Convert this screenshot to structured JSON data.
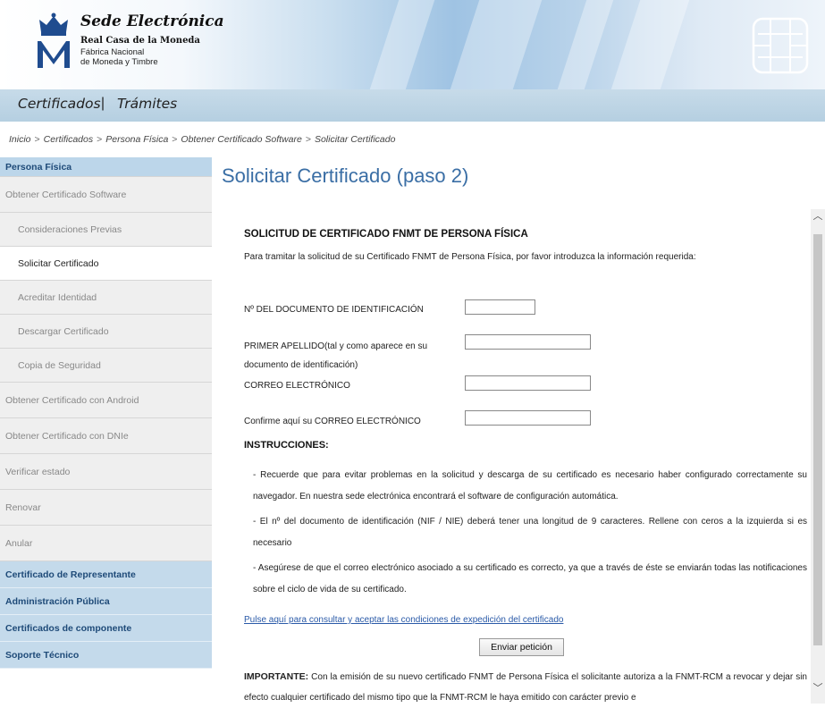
{
  "header": {
    "brand_title": "Sede Electrónica",
    "brand_line1": "Real Casa de la Moneda",
    "brand_line2": "Fábrica Nacional",
    "brand_line3": "de Moneda y Timbre"
  },
  "nav": {
    "certificados": "Certificados",
    "separator": "|",
    "tramites": "Trámites"
  },
  "breadcrumb": {
    "items": [
      "Inicio",
      "Certificados",
      "Persona Física",
      "Obtener Certificado Software",
      "Solicitar Certificado"
    ],
    "separator": ">"
  },
  "sidebar": {
    "header": "Persona Física",
    "group1": "Obtener Certificado Software",
    "sub_items": [
      "Consideraciones Previas",
      "Solicitar Certificado",
      "Acreditar Identidad",
      "Descargar Certificado",
      "Copia de Seguridad"
    ],
    "active_item": "Solicitar Certificado",
    "more_items": [
      "Obtener Certificado con Android",
      "Obtener Certificado con DNIe",
      "Verificar estado",
      "Renovar",
      "Anular"
    ],
    "categories": [
      "Certificado de Representante",
      "Administración Pública",
      "Certificados de componente",
      "Soporte Técnico"
    ]
  },
  "main": {
    "title": "Solicitar Certificado (paso 2)",
    "form_heading": "SOLICITUD DE CERTIFICADO FNMT DE PERSONA FÍSICA",
    "intro": "Para tramitar la solicitud de su Certificado FNMT de Persona Física, por favor introduzca la información requerida:",
    "fields": {
      "doc_label": "Nº DEL DOCUMENTO DE IDENTIFICACIÓN",
      "doc_value": "",
      "apellido_label_l1": "PRIMER APELLIDO(tal y como aparece en su",
      "apellido_label_l2": "documento de identificación)",
      "apellido_value": "",
      "email_label": "CORREO ELECTRÓNICO",
      "email_value": "",
      "email_confirm_label": "Confirme aquí su CORREO ELECTRÓNICO",
      "email_confirm_value": ""
    },
    "instructions_heading": "INSTRUCCIONES:",
    "instructions": [
      "- Recuerde que para evitar problemas en la solicitud y descarga de su certificado es necesario haber configurado correctamente su navegador. En nuestra sede electrónica encontrará el software de configuración automática.",
      "- El nº del documento de identificación (NIF / NIE) deberá tener una longitud de 9 caracteres. Rellene con ceros a la izquierda si es necesario",
      "- Asegúrese de que el correo electrónico asociado a su certificado es correcto, ya que a través de éste se enviarán todas las notificaciones sobre el ciclo de vida de su certificado."
    ],
    "conditions_link": "Pulse aquí para consultar y aceptar las condiciones de expedición del certificado",
    "submit_label": "Enviar petición",
    "important_label": "IMPORTANTE:",
    "important_text": " Con la emisión de su nuevo certificado FNMT de Persona Física el solicitante autoriza a la FNMT-RCM a revocar y dejar sin efecto cualquier certificado del mismo tipo que la FNMT-RCM le haya emitido con carácter previo e"
  },
  "icons": {
    "logo": "crown-m-logo-icon",
    "chip": "smartcard-chip-icon",
    "scroll_up": "chevron-up-icon",
    "scroll_down": "chevron-down-icon"
  },
  "colors": {
    "title_blue": "#3a6ea5",
    "sidebar_header": "#bcd6ea",
    "link": "#2a5aa8"
  }
}
